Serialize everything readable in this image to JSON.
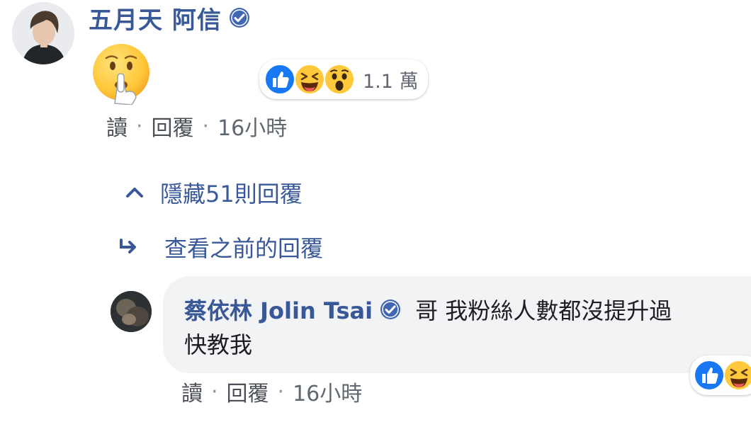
{
  "comment": {
    "author": "五月天 阿信",
    "verified": true,
    "content_emoji": "shushing-face",
    "reactions": {
      "types": [
        "like",
        "haha",
        "wow"
      ],
      "count": "1.1 萬"
    },
    "actions": {
      "like": "讀",
      "reply": "回覆",
      "time": "16小時"
    }
  },
  "replies_toggle": {
    "hide_label": "隱藏51則回覆"
  },
  "previous_replies": {
    "label": "查看之前的回覆"
  },
  "reply": {
    "author": "蔡依林 Jolin Tsai",
    "verified": true,
    "text_line1": "哥 我粉絲人數都沒提升過",
    "text_line2": "快教我",
    "reactions": {
      "types": [
        "like",
        "haha"
      ]
    },
    "actions": {
      "like": "讀",
      "reply": "回覆",
      "time": "16小時"
    }
  },
  "colors": {
    "link_blue": "#385898",
    "meta_gray": "#606770",
    "bubble_bg": "#f2f3f5",
    "like_blue": "#1877f2",
    "emoji_yellow": "#ffc93b"
  }
}
